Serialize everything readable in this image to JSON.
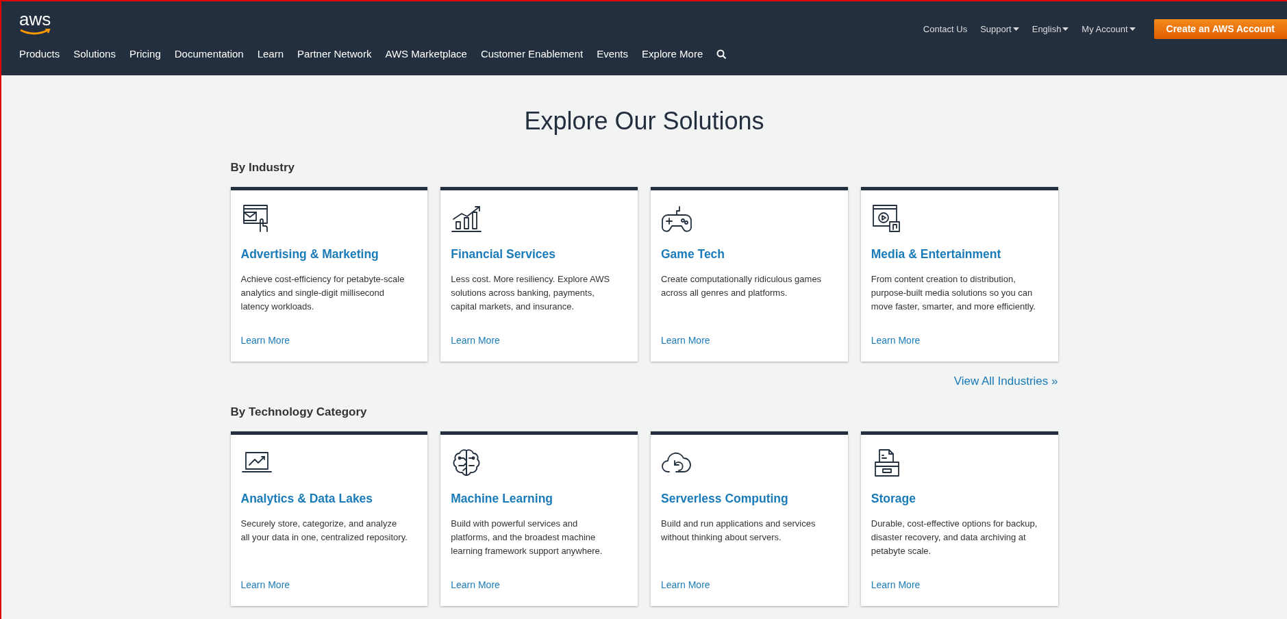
{
  "header": {
    "logo": "aws",
    "top_links": [
      {
        "label": "Contact Us",
        "dropdown": false
      },
      {
        "label": "Support",
        "dropdown": true
      },
      {
        "label": "English",
        "dropdown": true
      },
      {
        "label": "My Account",
        "dropdown": true
      }
    ],
    "cta": "Create an AWS Account",
    "nav": [
      "Products",
      "Solutions",
      "Pricing",
      "Documentation",
      "Learn",
      "Partner Network",
      "AWS Marketplace",
      "Customer Enablement",
      "Events",
      "Explore More"
    ]
  },
  "title": "Explore Our Solutions",
  "sections": [
    {
      "heading": "By Industry",
      "cards": [
        {
          "kind": "mail",
          "title": "Advertising & Marketing",
          "text": "Achieve cost-efficiency for petabyte-scale analytics and single-digit millisecond latency workloads.",
          "link": "Learn More"
        },
        {
          "kind": "chart",
          "title": "Financial Services",
          "text": "Less cost. More resiliency. Explore AWS solutions across banking, payments, capital markets, and insurance.",
          "link": "Learn More"
        },
        {
          "kind": "gamepad",
          "title": "Game Tech",
          "text": "Create computationally ridiculous games across all genres and platforms.",
          "link": "Learn More"
        },
        {
          "kind": "media",
          "title": "Media & Entertainment",
          "text": "From content creation to distribution, purpose-built media solutions so you can move faster, smarter, and more efficiently.",
          "link": "Learn More"
        }
      ],
      "more": "View All Industries »"
    },
    {
      "heading": "By Technology Category",
      "cards": [
        {
          "kind": "laptop",
          "title": "Analytics & Data Lakes",
          "text": "Securely store, categorize, and analyze all your data in one, centralized repository.",
          "link": "Learn More"
        },
        {
          "kind": "brain",
          "title": "Machine Learning",
          "text": "Build with powerful services and platforms, and the broadest machine learning framework support anywhere.",
          "link": "Learn More"
        },
        {
          "kind": "cloud",
          "title": "Serverless Computing",
          "text": "Build and run applications and services without thinking about servers.",
          "link": "Learn More"
        },
        {
          "kind": "storage",
          "title": "Storage",
          "text": "Durable, cost-effective options for backup, disaster recovery, and data archiving at petabyte scale.",
          "link": "Learn More"
        }
      ]
    }
  ]
}
